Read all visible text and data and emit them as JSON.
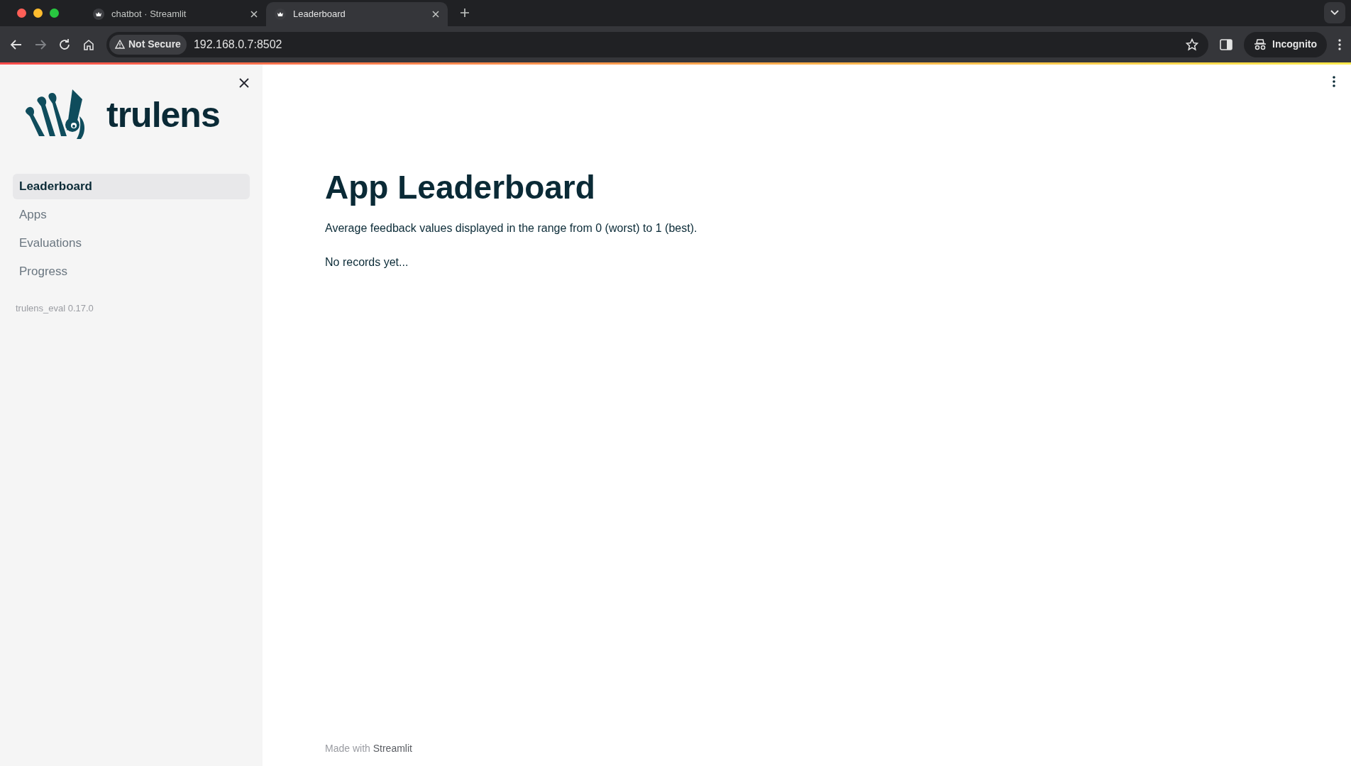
{
  "browser": {
    "tabs": [
      {
        "title": "chatbot · Streamlit",
        "selected": false
      },
      {
        "title": "Leaderboard",
        "selected": true
      }
    ],
    "security_label": "Not Secure",
    "address": "192.168.0.7:8502",
    "profile": "Incognito"
  },
  "sidebar": {
    "brand": "trulens",
    "items": [
      {
        "label": "Leaderboard",
        "selected": true
      },
      {
        "label": "Apps",
        "selected": false
      },
      {
        "label": "Evaluations",
        "selected": false
      },
      {
        "label": "Progress",
        "selected": false
      }
    ],
    "version": "trulens_eval 0.17.0"
  },
  "main": {
    "title": "App Leaderboard",
    "description": "Average feedback values displayed in the range from 0 (worst) to 1 (best).",
    "message": "No records yet..."
  },
  "footer": {
    "prefix": "Made with",
    "link": "Streamlit"
  }
}
